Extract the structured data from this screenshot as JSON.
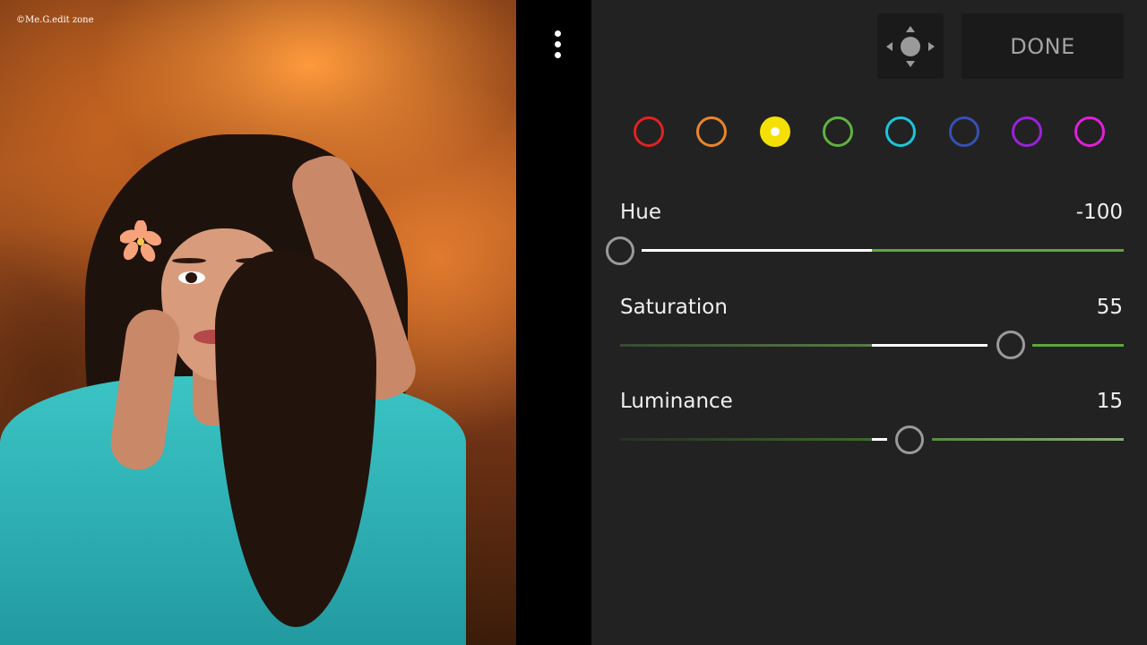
{
  "photo": {
    "watermark": "©Me.G.edit zone"
  },
  "toolbar": {
    "menu_icon": "more-vertical-icon",
    "move_icon": "move-target-icon",
    "done_label": "DONE"
  },
  "color_swatches": [
    {
      "name": "red",
      "color": "#e02222",
      "selected": false
    },
    {
      "name": "orange",
      "color": "#e8862a",
      "selected": false
    },
    {
      "name": "yellow",
      "color": "#f4e004",
      "selected": true
    },
    {
      "name": "green",
      "color": "#5fb240",
      "selected": false
    },
    {
      "name": "aqua",
      "color": "#18c8dc",
      "selected": false
    },
    {
      "name": "blue",
      "color": "#3750b4",
      "selected": false
    },
    {
      "name": "purple",
      "color": "#9a22d8",
      "selected": false
    },
    {
      "name": "magenta",
      "color": "#e020d8",
      "selected": false
    }
  ],
  "sliders": {
    "hue": {
      "label": "Hue",
      "value": "-100"
    },
    "saturation": {
      "label": "Saturation",
      "value": "55"
    },
    "luminance": {
      "label": "Luminance",
      "value": "15"
    }
  },
  "colors": {
    "panel_bg": "#222222",
    "track_green": "#5fa83a",
    "thumb_border": "#9a9a9a"
  }
}
